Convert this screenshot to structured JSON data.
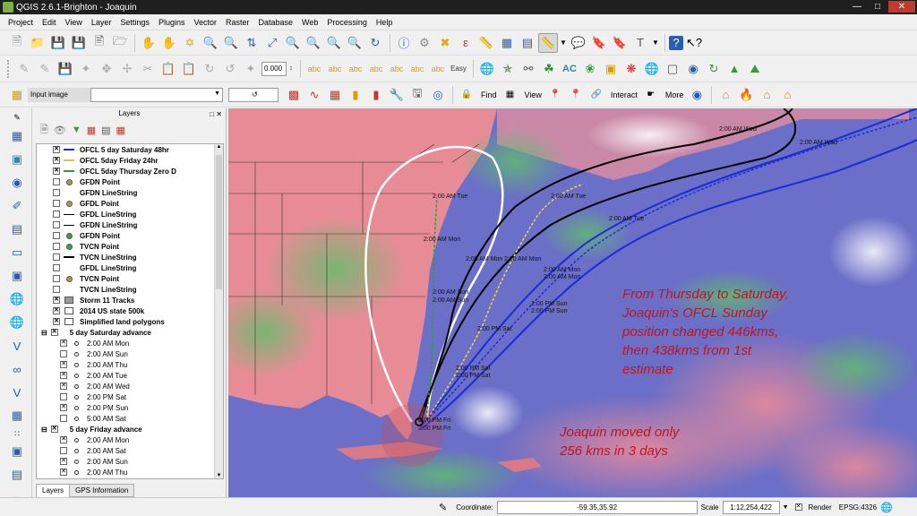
{
  "window": {
    "title": "QGIS 2.6.1-Brighton - Joaquin"
  },
  "menu": [
    "Project",
    "Edit",
    "View",
    "Layer",
    "Settings",
    "Plugins",
    "Vector",
    "Raster",
    "Database",
    "Web",
    "Processing",
    "Help"
  ],
  "toolbar2": {
    "rotation_value": "0.000"
  },
  "toolbar3": {
    "input_combo": "Input image",
    "find_label": "Find",
    "view_label": "View",
    "interact_label": "Interact",
    "more_label": "More"
  },
  "layers_panel": {
    "title": "Layers",
    "items": [
      {
        "label": "OFCL 5 day Saturday 48hr",
        "checked": "x",
        "sym": "dash-blue",
        "sub": false
      },
      {
        "label": "OFCL 5day Friday 24hr",
        "checked": "x",
        "sym": "dash-yellow",
        "sub": false
      },
      {
        "label": "OFCL 5day Thursday Zero D",
        "checked": "x",
        "sym": "dash-green",
        "sub": false
      },
      {
        "label": "GFDN Point",
        "checked": "",
        "sym": "dot-olive",
        "sub": false
      },
      {
        "label": "GFDN LineString",
        "checked": "",
        "sym": "none",
        "sub": false
      },
      {
        "label": "GFDL Point",
        "checked": "",
        "sym": "dot-olive",
        "sub": false
      },
      {
        "label": "GFDL LineString",
        "checked": "",
        "sym": "line-black",
        "sub": false
      },
      {
        "label": "GFDN LineString",
        "checked": "",
        "sym": "line-black",
        "sub": false
      },
      {
        "label": "GFDN Point",
        "checked": "",
        "sym": "dot-green",
        "sub": false
      },
      {
        "label": "TVCN Point",
        "checked": "",
        "sym": "dot-green",
        "sub": false
      },
      {
        "label": "TVCN LineString",
        "checked": "",
        "sym": "dash-black",
        "sub": false
      },
      {
        "label": "GFDL LineString",
        "checked": "",
        "sym": "none",
        "sub": false
      },
      {
        "label": "TVCN Point",
        "checked": "",
        "sym": "dot-olive",
        "sub": false
      },
      {
        "label": "TVCN LineString",
        "checked": "",
        "sym": "none",
        "sub": false
      },
      {
        "label": "Storm 11 Tracks",
        "checked": "x",
        "sym": "raster",
        "sub": false
      },
      {
        "label": "2014 US state 500k",
        "checked": "x",
        "sym": "box",
        "sub": false
      },
      {
        "label": "Simplified land polygons",
        "checked": "x",
        "sym": "box",
        "sub": false
      },
      {
        "label": "5 day Saturday advance",
        "checked": "x",
        "sym": "group",
        "sub": false
      },
      {
        "label": "2:00 AM Mon",
        "checked": "x",
        "sym": "circle",
        "sub": true
      },
      {
        "label": "2:00 AM Sun",
        "checked": "",
        "sym": "circle",
        "sub": true
      },
      {
        "label": "2:00 AM Thu",
        "checked": "x",
        "sym": "circle",
        "sub": true
      },
      {
        "label": "2:00 AM Tue",
        "checked": "x",
        "sym": "circle",
        "sub": true
      },
      {
        "label": "2:00 AM Wed",
        "checked": "x",
        "sym": "circle",
        "sub": true
      },
      {
        "label": "2:00 PM Sat",
        "checked": "",
        "sym": "circle",
        "sub": true
      },
      {
        "label": "2:00 PM Sun",
        "checked": "x",
        "sym": "circle",
        "sub": true
      },
      {
        "label": "5:00 AM Sat",
        "checked": "",
        "sym": "circle",
        "sub": true
      },
      {
        "label": "5 day Friday advance",
        "checked": "x",
        "sym": "group",
        "sub": false
      },
      {
        "label": "2:00 AM Mon",
        "checked": "x",
        "sym": "circle",
        "sub": true
      },
      {
        "label": "2:00 AM Sat",
        "checked": "",
        "sym": "circle",
        "sub": true
      },
      {
        "label": "2:00 AM Sun",
        "checked": "x",
        "sym": "circle",
        "sub": true
      },
      {
        "label": "2:00 AM Thu",
        "checked": "x",
        "sym": "circle",
        "sub": true
      }
    ],
    "tabs": [
      "Layers",
      "GPS Information"
    ]
  },
  "map": {
    "annotation_1": [
      "From Thursday to Saturday,",
      "Joaquin's OFCL Sunday",
      "position changed 446kms,",
      "then 438kms from 1st",
      "estimate"
    ],
    "annotation_2": [
      "Joaquin moved only",
      "256 kms in 3 days"
    ],
    "annotation_color": "#c0141e",
    "labels": [
      "2:00 AM Wed",
      "2:00 AM Wed",
      "2:00 AM Tue",
      "2:00 AM Tue",
      "2:00 AM Tue",
      "2:00 AM Mon",
      "2:00 AM Mon",
      "2:00 AM Mon",
      "2:00 AM Mon",
      "2:00 AM Mon",
      "2:00 AM Sun",
      "2:00 AM Sun",
      "2:00 PM Sun",
      "2:00 PM Sun",
      "2:00 PM Sat",
      "2:00 PM Sat",
      "2:00 PM Sat",
      "2:00 PM Fri",
      "2:00 PM Fri"
    ]
  },
  "status": {
    "coordinate_label": "Coordinate:",
    "coordinate_value": "-59.35,35.92",
    "scale_label": "Scale",
    "scale_value": "1:12,254,422",
    "render_label": "Render",
    "epsg": "EPSG:4326"
  }
}
